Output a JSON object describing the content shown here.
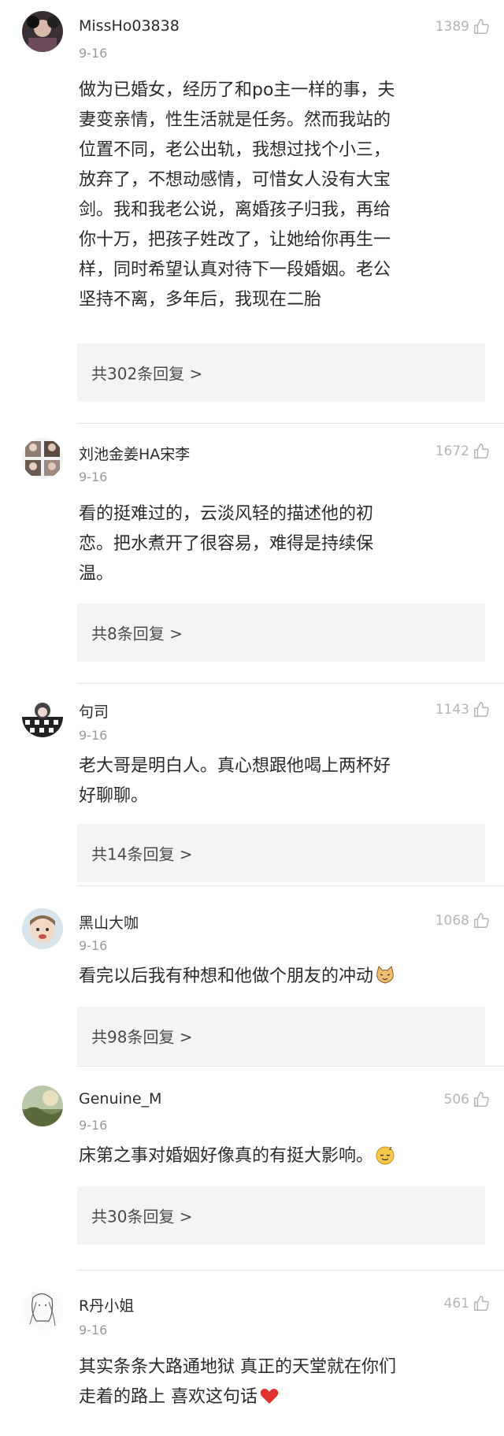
{
  "comments": [
    {
      "user": "MissHo03838",
      "date": "9-16",
      "likes": "1389",
      "text_lines": [
        "做为已婚女，经历了和po主一样的事，夫",
        "妻变亲情，性生活就是任务。然而我站的",
        "位置不同，老公出轨，我想过找个小三，",
        "放弃了，不想动感情，可惜女人没有大宝",
        "剑。我和我老公说，离婚孩子归我，再给",
        "你十万，把孩子姓改了，让她给你再生一",
        "样，同时希望认真对待下一段婚姻。老公",
        "坚持不离，多年后，我现在二胎"
      ],
      "replies": "共302条回复 >"
    },
    {
      "user": "刘池金姜HA宋李",
      "date": "9-16",
      "likes": "1672",
      "text_lines": [
        "看的挺难过的，云淡风轻的描述他的初",
        "恋。把水煮开了很容易，难得是持续保",
        "温。"
      ],
      "replies": "共8条回复 >"
    },
    {
      "user": "句司",
      "date": "9-16",
      "likes": "1143",
      "text_lines": [
        "老大哥是明白人。真心想跟他喝上两杯好",
        "好聊聊。"
      ],
      "replies": "共14条回复 >"
    },
    {
      "user": "黑山大咖",
      "date": "9-16",
      "likes": "1068",
      "text_lines": [
        "看完以后我有种想和他做个朋友的冲动"
      ],
      "emoji": "cat-face-emoji",
      "replies": "共98条回复 >"
    },
    {
      "user": "Genuine_M",
      "date": "9-16",
      "likes": "506",
      "text_lines": [
        "床第之事对婚姻好像真的有挺大影响。"
      ],
      "emoji": "sleepy-face-emoji",
      "replies": "共30条回复 >"
    },
    {
      "user": "R丹小姐",
      "date": "9-16",
      "likes": "461",
      "text_lines": [
        "其实条条大路通地狱 真正的天堂就在你们",
        "走着的路上 喜欢这句话"
      ],
      "emoji": "red-heart-emoji",
      "replies": null
    }
  ],
  "colors": {
    "username": "#2b2b2b",
    "meta": "#9a9a9a",
    "reply_bg": "#f4f4f4",
    "heart": "#e0312f"
  }
}
